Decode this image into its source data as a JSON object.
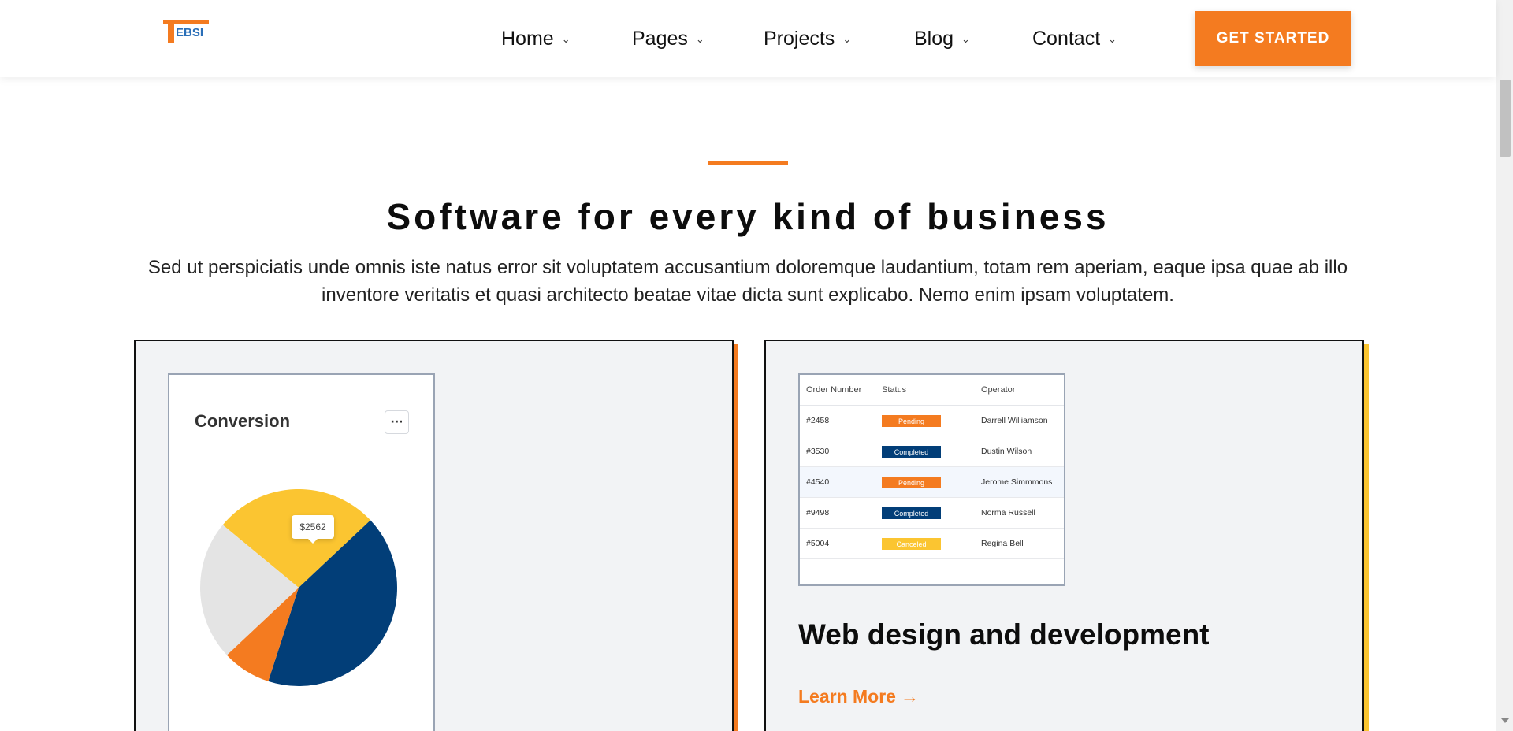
{
  "header": {
    "logo_text": "EBSI",
    "nav": [
      {
        "label": "Home"
      },
      {
        "label": "Pages"
      },
      {
        "label": "Projects"
      },
      {
        "label": "Blog"
      },
      {
        "label": "Contact"
      }
    ],
    "cta_label": "GET STARTED",
    "accent_color": "#f47b20"
  },
  "section": {
    "title": "Software for every kind of business",
    "description": "Sed ut perspiciatis unde omnis iste natus error sit voluptatem accusantium doloremque laudantium, totam rem aperiam, eaque ipsa quae ab illo inventore veritatis et quasi architecto beatae vitae dicta sunt explicabo. Nemo enim ipsam voluptatem."
  },
  "cards": {
    "left": {
      "widget_title": "Conversion",
      "more_icon": "more-horizontal-icon",
      "tooltip": "$2562",
      "chart_data": {
        "type": "pie",
        "slices": [
          {
            "value": 27,
            "color": "#fbc531"
          },
          {
            "value": 42,
            "color": "#023e78"
          },
          {
            "value": 8,
            "color": "#f47b20"
          },
          {
            "value": 23,
            "color": "#e4e4e4"
          }
        ]
      }
    },
    "right": {
      "table": {
        "headers": [
          "Order Number",
          "Status",
          "Operator"
        ],
        "rows": [
          {
            "order": "#2458",
            "status": "Pending",
            "status_color": "#f47b20",
            "operator": "Darrell Williamson"
          },
          {
            "order": "#3530",
            "status": "Completed",
            "status_color": "#023e78",
            "operator": "Dustin Wilson"
          },
          {
            "order": "#4540",
            "status": "Pending",
            "status_color": "#f47b20",
            "operator": "Jerome Simmmons"
          },
          {
            "order": "#9498",
            "status": "Completed",
            "status_color": "#023e78",
            "operator": "Norma Russell"
          },
          {
            "order": "#5004",
            "status": "Canceled",
            "status_color": "#fbc531",
            "operator": "Regina Bell"
          }
        ]
      },
      "heading": "Web design and development",
      "link_label": "Learn More",
      "link_arrow": "→"
    }
  }
}
